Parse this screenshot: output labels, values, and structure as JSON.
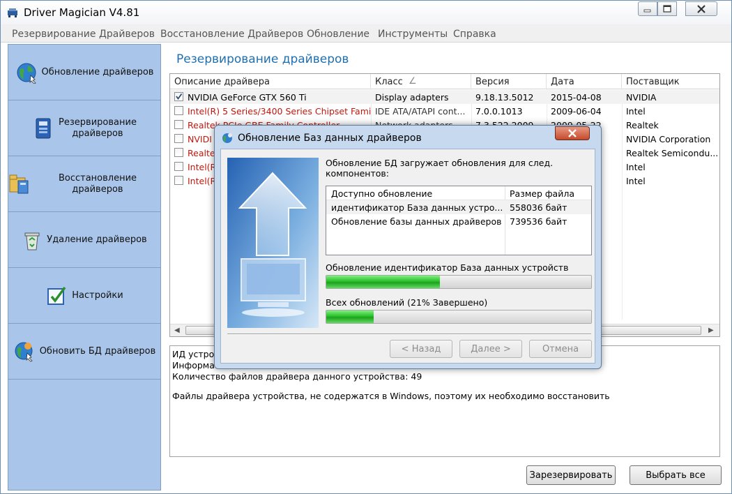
{
  "window": {
    "title": "Driver Magician V4.81"
  },
  "menu": [
    "Резервирование Драйверов",
    "Восстановление Драйверов",
    "Обновление",
    "Инструменты",
    "Справка"
  ],
  "sidebar": [
    {
      "label": "Обновление драйверов",
      "icon": "globe-icon"
    },
    {
      "label": "Резервирование\nдрайверов",
      "icon": "backup-icon"
    },
    {
      "label": "Восстановление драйверов",
      "icon": "restore-icon"
    },
    {
      "label": "Удаление драйверов",
      "icon": "recycle-bin-icon"
    },
    {
      "label": "Настройки",
      "icon": "settings-check-icon"
    },
    {
      "label": "Обновить БД драйверов",
      "icon": "update-db-icon"
    }
  ],
  "main": {
    "title": "Резервирование драйверов",
    "columns": [
      "Описание драйвера",
      "Класс",
      "Версия",
      "Дата",
      "Поставщик"
    ],
    "sort_indicator": "∠",
    "rows": [
      {
        "checked": true,
        "red": false,
        "name": "NVIDIA GeForce GTX 560 Ti",
        "class": "Display adapters",
        "version": "9.18.13.5012",
        "date": "2015-04-08",
        "vendor": "NVIDIA"
      },
      {
        "checked": false,
        "red": true,
        "name": "Intel(R) 5 Series/3400 Series Chipset Famil...",
        "class": "IDE ATA/ATAPI cont...",
        "version": "7.0.0.1013",
        "date": "2009-06-04",
        "vendor": "Intel"
      },
      {
        "checked": false,
        "red": true,
        "name": "Realtek PCIe GBE Family Controller",
        "class": "Network adapters",
        "version": "7.3.522.2009",
        "date": "2009-05-22",
        "vendor": "Realtek"
      },
      {
        "checked": false,
        "red": true,
        "name": "NVIDI",
        "class": "",
        "version": "",
        "date": "",
        "vendor": "NVIDIA Corporation"
      },
      {
        "checked": false,
        "red": true,
        "name": "Realte",
        "class": "",
        "version": "",
        "date": "",
        "vendor": "Realtek Semicondu..."
      },
      {
        "checked": false,
        "red": true,
        "name": "Intel(R",
        "class": "",
        "version": "",
        "date": "",
        "vendor": "Intel"
      },
      {
        "checked": false,
        "red": true,
        "name": "Intel(R",
        "class": "",
        "version": "",
        "date": "",
        "vendor": "Intel"
      }
    ],
    "details": [
      "ИД устро",
      "Информа",
      "Количество файлов драйвера данного устройства: 49",
      "",
      "Файлы драйвера устройства, не содержатся в Windows, поэтому их необходимо восстановить"
    ],
    "buttons": {
      "backup": "Зарезервировать",
      "select_all": "Выбрать все"
    }
  },
  "dialog": {
    "title": "Обновление Баз данных драйверов",
    "message": "Обновление БД загружает обновления для след. компонентов:",
    "table_headers": [
      "Доступно обновление",
      "Размер файла"
    ],
    "table_rows": [
      {
        "name": "идентификатор База данных устро...",
        "size": "558036 байт"
      },
      {
        "name": "Обновление базы данных драйверов",
        "size": "739536 байт"
      }
    ],
    "current_label": "Обновление идентификатор База данных устройств",
    "current_progress": 0.43,
    "total_label": "Всех обновлений (21% Завершено)",
    "total_progress": 0.18,
    "buttons": {
      "back": "< Назад",
      "next": "Далее >",
      "cancel": "Отмена"
    }
  }
}
